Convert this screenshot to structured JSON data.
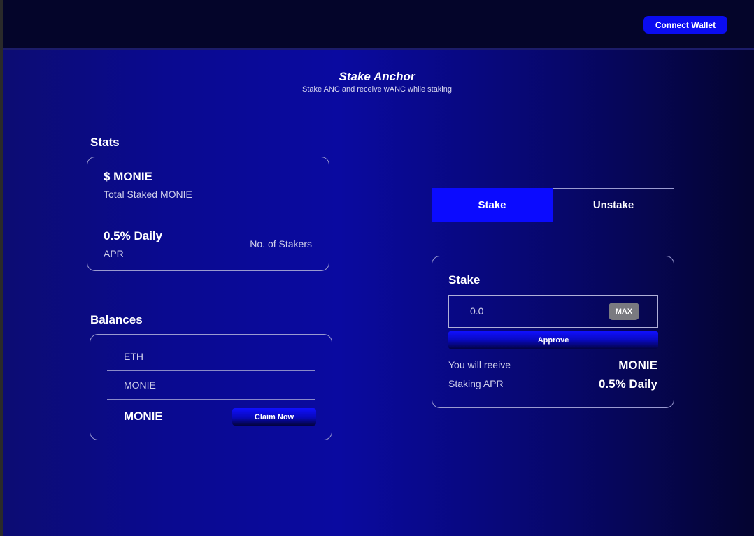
{
  "header": {
    "connect_wallet_label": "Connect Wallet"
  },
  "hero": {
    "title": "Stake Anchor",
    "subtitle": "Stake ANC and receive wANC while staking"
  },
  "stats": {
    "section_label": "Stats",
    "total_staked_value": "$ MONIE",
    "total_staked_caption": "Total Staked MONIE",
    "apr_value": "0.5% Daily",
    "apr_caption": "APR",
    "stakers_label": "No. of Stakers"
  },
  "balances": {
    "section_label": "Balances",
    "rows": [
      {
        "label": "ETH"
      },
      {
        "label": "MONIE"
      },
      {
        "label": "MONIE"
      }
    ],
    "claim_label": "Claim Now"
  },
  "tabs": [
    {
      "label": "Stake",
      "active": true
    },
    {
      "label": "Unstake",
      "active": false
    }
  ],
  "stake_panel": {
    "title": "Stake",
    "amount_placeholder": "0.0",
    "max_label": "MAX",
    "approve_label": "Approve",
    "receive_label": "You will reeive",
    "receive_value": "MONIE",
    "apr_label": "Staking APR",
    "apr_value": "0.5% Daily"
  },
  "colors": {
    "accent": "#0b0bff",
    "topbar": "#04052a",
    "card_border": "#9a9ad0",
    "max_button": "#7a7a80"
  }
}
